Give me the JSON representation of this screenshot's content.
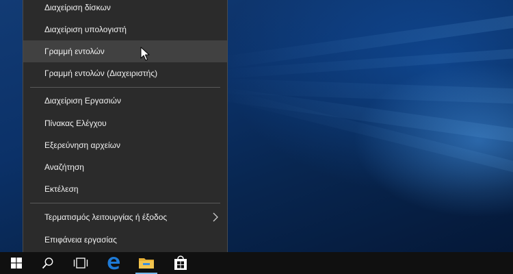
{
  "menu": {
    "items": [
      {
        "label": "Διαχείριση δίσκων"
      },
      {
        "label": "Διαχείριση υπολογιστή"
      },
      {
        "label": "Γραμμή εντολών"
      },
      {
        "label": "Γραμμή εντολών (Διαχειριστής)"
      },
      {
        "label": "Διαχείριση Εργασιών"
      },
      {
        "label": "Πίνακας Ελέγχου"
      },
      {
        "label": "Εξερεύνηση αρχείων"
      },
      {
        "label": "Αναζήτηση"
      },
      {
        "label": "Εκτέλεση"
      },
      {
        "label": "Τερματισμός λειτουργίας ή έξοδος"
      },
      {
        "label": "Επιφάνεια εργασίας"
      }
    ],
    "hovered_item": "Γραμμή εντολών"
  },
  "taskbar": {
    "buttons": [
      {
        "icon": "windows-start-icon"
      },
      {
        "icon": "search-icon"
      },
      {
        "icon": "task-view-icon"
      },
      {
        "icon": "edge-browser-icon"
      },
      {
        "icon": "file-explorer-icon"
      },
      {
        "icon": "store-icon"
      }
    ]
  },
  "colors": {
    "menu_bg": "#2b2b2b",
    "menu_hover": "#414141",
    "taskbar_bg": "#101010",
    "accent": "#76b9ed",
    "edge_blue": "#1e7ad6",
    "folder_yellow": "#f2c44e"
  }
}
